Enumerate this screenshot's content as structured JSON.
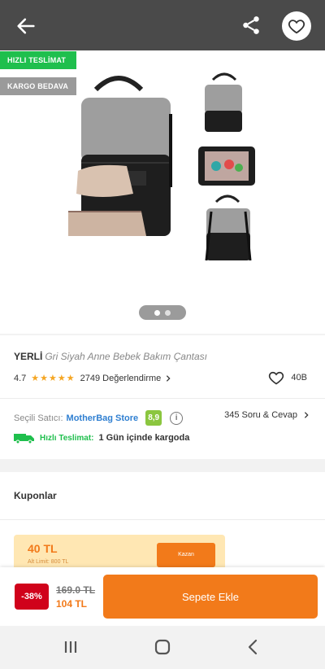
{
  "colors": {
    "accent": "#f27a1a",
    "fast_green": "#1fbf4d",
    "discount_red": "#d0021b",
    "seller_blue": "#2f7fd1",
    "score_green": "#8bc63f"
  },
  "hero": {
    "badges": {
      "fast": "HIZLI TESLİMAT",
      "cargo": "KARGO BEDAVA"
    },
    "gallery": {
      "current": 1,
      "total": 2
    }
  },
  "product": {
    "brand": "YERLİ",
    "name": "Gri Siyah Anne Bebek Bakım Çantası",
    "rating": "4.7",
    "reviews": "2749 Değerlendirme",
    "likes": "40B"
  },
  "seller": {
    "label": "Seçili Satıcı:",
    "name": "MotherBag Store",
    "score": "8,9",
    "questions": "345 Soru & Cevap"
  },
  "shipping": {
    "label": "Hızlı Teslimat:",
    "time": "1 Gün içinde kargoda"
  },
  "coupons": {
    "heading": "Kuponlar",
    "card": {
      "amount": "40 TL",
      "limit": "Alt Limit: 800 TL",
      "claim": "Kazan"
    }
  },
  "buy": {
    "discount": "-38%",
    "old_price": "169.0 TL",
    "new_price": "104 TL",
    "add_to_cart": "Sepete Ekle"
  },
  "icons": {
    "back": "arrow-left-icon",
    "share": "share-icon",
    "favorite": "heart-icon",
    "info": "info-icon",
    "truck": "truck-icon",
    "chevron": "chevron-right-icon"
  }
}
